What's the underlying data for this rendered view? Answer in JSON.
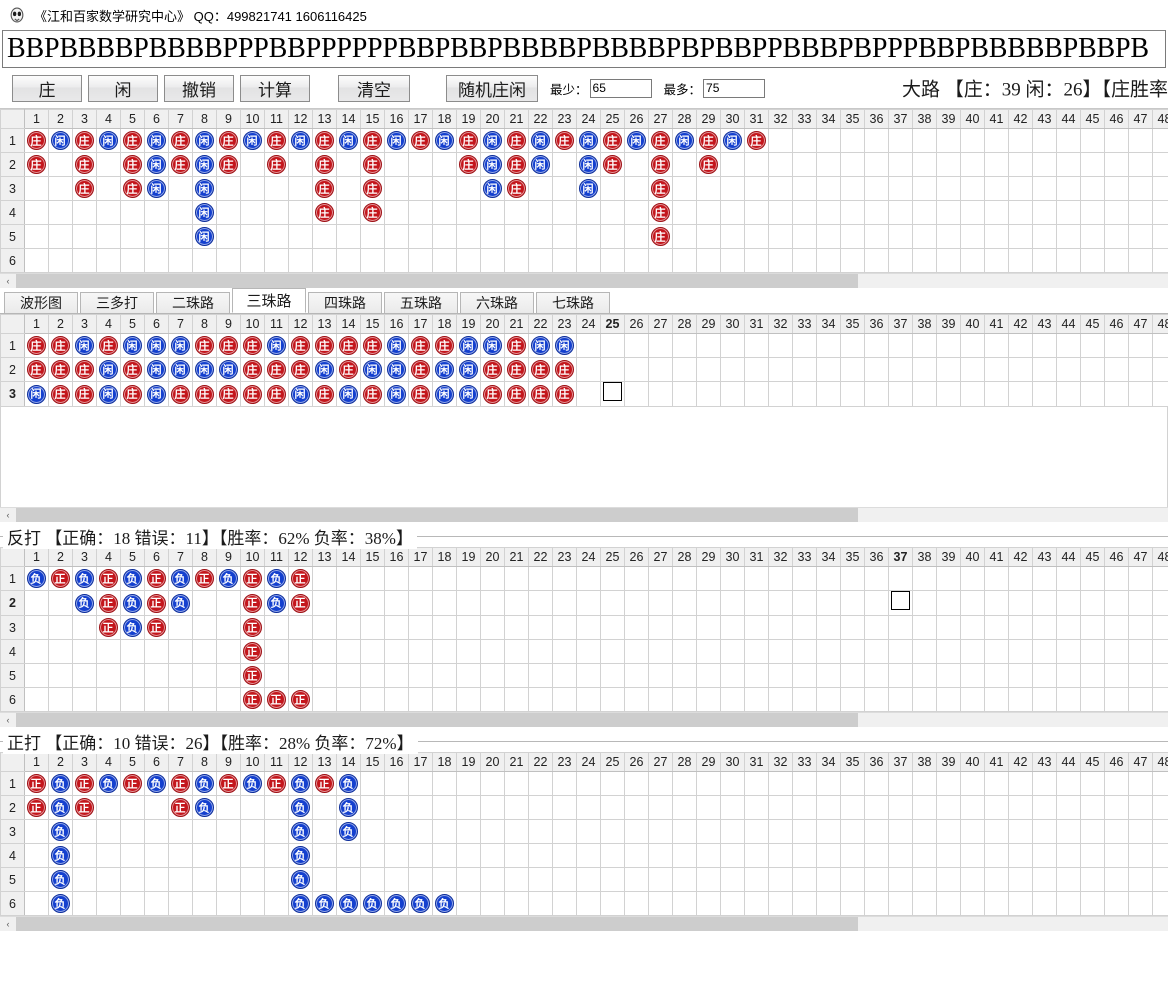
{
  "window": {
    "icon": "app-icon",
    "title": "《江和百家数学研究中心》 QQ：499821741 1606116425"
  },
  "sequence": {
    "value": "BBPBBBBPBBBBPPPBBPPPPPPBBPBBPBBBBPBBBBPBPBBPPBBBPBPPPBBPBBBBBPBBPB"
  },
  "toolbar": {
    "banker_label": "庄",
    "player_label": "闲",
    "undo_label": "撤销",
    "calc_label": "计算",
    "clear_label": "清空",
    "random_label": "随机庄闲",
    "min_label": "最少：",
    "min_value": "65",
    "max_label": "最多：",
    "max_value": "75",
    "stats": "大路 【庄：39 闲：26】【庄胜率"
  },
  "tabs": [
    {
      "label": "波形图",
      "active": false
    },
    {
      "label": "三多打",
      "active": false
    },
    {
      "label": "二珠路",
      "active": false
    },
    {
      "label": "三珠路",
      "active": true
    },
    {
      "label": "四珠路",
      "active": false
    },
    {
      "label": "五珠路",
      "active": false
    },
    {
      "label": "六珠路",
      "active": false
    },
    {
      "label": "七珠路",
      "active": false
    }
  ],
  "marker_labels": {
    "B": "庄",
    "P": "闲",
    "Z": "正",
    "F": "负"
  },
  "big_road": {
    "columns": 48,
    "rows": 6,
    "row_labels": [
      "1",
      "2",
      "3",
      "4",
      "5",
      "6"
    ],
    "cells": [
      [
        "B",
        "P",
        "B",
        "P",
        "B",
        "P",
        "B",
        "P",
        "B",
        "P",
        "B",
        "P",
        "B",
        "P",
        "B",
        "P",
        "B",
        "P",
        "B",
        "P",
        "B",
        "P",
        "B",
        "P",
        "B",
        "P",
        "B",
        "P",
        "B",
        "P",
        "B",
        "",
        "",
        "",
        "",
        "",
        "",
        "",
        "",
        "",
        "",
        "",
        "",
        "",
        "",
        "",
        "",
        ""
      ],
      [
        "B",
        "",
        "B",
        "",
        "B",
        "P",
        "B",
        "P",
        "B",
        "",
        "B",
        "",
        "B",
        "",
        "B",
        "",
        "",
        "",
        "B",
        "P",
        "B",
        "P",
        "",
        "P",
        "B",
        "",
        "B",
        "",
        "B",
        "",
        "",
        "",
        "",
        "",
        "",
        "",
        "",
        "",
        "",
        "",
        "",
        "",
        "",
        "",
        "",
        "",
        "",
        ""
      ],
      [
        "",
        "",
        "B",
        "",
        "B",
        "P",
        "",
        "P",
        "",
        "",
        "",
        "",
        "B",
        "",
        "B",
        "",
        "",
        "",
        "",
        "P",
        "B",
        "",
        "",
        "P",
        "",
        "",
        "B",
        "",
        "",
        "",
        "",
        "",
        "",
        "",
        "",
        "",
        "",
        "",
        "",
        "",
        "",
        "",
        "",
        "",
        "",
        "",
        "",
        ""
      ],
      [
        "",
        "",
        "",
        "",
        "",
        "",
        "",
        "P",
        "",
        "",
        "",
        "",
        "B",
        "",
        "B",
        "",
        "",
        "",
        "",
        "",
        "",
        "",
        "",
        "",
        "",
        "",
        "B",
        "",
        "",
        "",
        "",
        "",
        "",
        "",
        "",
        "",
        "",
        "",
        "",
        "",
        "",
        "",
        "",
        "",
        "",
        "",
        "",
        ""
      ],
      [
        "",
        "",
        "",
        "",
        "",
        "",
        "",
        "P",
        "",
        "",
        "",
        "",
        "",
        "",
        "",
        "",
        "",
        "",
        "",
        "",
        "",
        "",
        "",
        "",
        "",
        "",
        "B",
        "",
        "",
        "",
        "",
        "",
        "",
        "",
        "",
        "",
        "",
        "",
        "",
        "",
        "",
        "",
        "",
        "",
        "",
        "",
        "",
        ""
      ],
      [
        "",
        "",
        "",
        "",
        "",
        "",
        "",
        "",
        "",
        "",
        "",
        "",
        "",
        "",
        "",
        "",
        "",
        "",
        "",
        "",
        "",
        "",
        "",
        "",
        "",
        "",
        "",
        "",
        "",
        "",
        "",
        "",
        "",
        "",
        "",
        "",
        "",
        "",
        "",
        "",
        "",
        "",
        "",
        "",
        "",
        "",
        "",
        ""
      ]
    ]
  },
  "bead_road": {
    "columns": 48,
    "rows": 3,
    "row_labels": [
      "1",
      "2",
      "3"
    ],
    "selected_column": 25,
    "selected_row": 3,
    "focus_cell": {
      "row": 3,
      "col": 25
    },
    "cells": [
      [
        "B",
        "B",
        "P",
        "B",
        "P",
        "P",
        "P",
        "B",
        "B",
        "B",
        "P",
        "B",
        "B",
        "B",
        "B",
        "P",
        "B",
        "B",
        "P",
        "P",
        "B",
        "P",
        "P",
        "",
        "",
        "",
        "",
        "",
        "",
        "",
        "",
        "",
        "",
        "",
        "",
        "",
        "",
        "",
        "",
        "",
        "",
        "",
        "",
        "",
        "",
        "",
        "",
        ""
      ],
      [
        "B",
        "B",
        "B",
        "P",
        "B",
        "P",
        "P",
        "P",
        "P",
        "B",
        "B",
        "B",
        "P",
        "B",
        "P",
        "P",
        "B",
        "P",
        "P",
        "B",
        "B",
        "B",
        "B",
        "",
        "",
        "",
        "",
        "",
        "",
        "",
        "",
        "",
        "",
        "",
        "",
        "",
        "",
        "",
        "",
        "",
        "",
        "",
        "",
        "",
        "",
        "",
        "",
        ""
      ],
      [
        "P",
        "B",
        "B",
        "P",
        "B",
        "P",
        "B",
        "B",
        "B",
        "B",
        "B",
        "P",
        "B",
        "P",
        "B",
        "P",
        "B",
        "P",
        "P",
        "B",
        "B",
        "B",
        "B",
        "",
        "",
        "",
        "",
        "",
        "",
        "",
        "",
        "",
        "",
        "",
        "",
        "",
        "",
        "",
        "",
        "",
        "",
        "",
        "",
        "",
        "",
        "",
        "",
        ""
      ]
    ]
  },
  "fanda": {
    "title": "反打 【正确：18 错误：11】【胜率：62% 负率：38%】",
    "columns": 48,
    "rows": 6,
    "row_labels": [
      "1",
      "2",
      "3",
      "4",
      "5",
      "6"
    ],
    "selected_column": 37,
    "selected_row": 2,
    "focus_cell": {
      "row": 2,
      "col": 37
    },
    "cells": [
      [
        "F",
        "Z",
        "F",
        "Z",
        "F",
        "Z",
        "F",
        "Z",
        "F",
        "Z",
        "F",
        "Z",
        "",
        "",
        "",
        "",
        "",
        "",
        "",
        "",
        "",
        "",
        "",
        "",
        "",
        "",
        "",
        "",
        "",
        "",
        "",
        "",
        "",
        "",
        "",
        "",
        "",
        "",
        "",
        "",
        "",
        "",
        "",
        "",
        "",
        "",
        "",
        ""
      ],
      [
        "",
        "",
        "F",
        "Z",
        "F",
        "Z",
        "F",
        "",
        "",
        "Z",
        "F",
        "Z",
        "",
        "",
        "",
        "",
        "",
        "",
        "",
        "",
        "",
        "",
        "",
        "",
        "",
        "",
        "",
        "",
        "",
        "",
        "",
        "",
        "",
        "",
        "",
        "",
        "",
        "",
        "",
        "",
        "",
        "",
        "",
        "",
        "",
        "",
        "",
        ""
      ],
      [
        "",
        "",
        "",
        "Z",
        "F",
        "Z",
        "",
        "",
        "",
        "Z",
        "",
        "",
        "",
        "",
        "",
        "",
        "",
        "",
        "",
        "",
        "",
        "",
        "",
        "",
        "",
        "",
        "",
        "",
        "",
        "",
        "",
        "",
        "",
        "",
        "",
        "",
        "",
        "",
        "",
        "",
        "",
        "",
        "",
        "",
        "",
        "",
        "",
        ""
      ],
      [
        "",
        "",
        "",
        "",
        "",
        "",
        "",
        "",
        "",
        "Z",
        "",
        "",
        "",
        "",
        "",
        "",
        "",
        "",
        "",
        "",
        "",
        "",
        "",
        "",
        "",
        "",
        "",
        "",
        "",
        "",
        "",
        "",
        "",
        "",
        "",
        "",
        "",
        "",
        "",
        "",
        "",
        "",
        "",
        "",
        "",
        "",
        "",
        ""
      ],
      [
        "",
        "",
        "",
        "",
        "",
        "",
        "",
        "",
        "",
        "Z",
        "",
        "",
        "",
        "",
        "",
        "",
        "",
        "",
        "",
        "",
        "",
        "",
        "",
        "",
        "",
        "",
        "",
        "",
        "",
        "",
        "",
        "",
        "",
        "",
        "",
        "",
        "",
        "",
        "",
        "",
        "",
        "",
        "",
        "",
        "",
        "",
        "",
        ""
      ],
      [
        "",
        "",
        "",
        "",
        "",
        "",
        "",
        "",
        "",
        "Z",
        "Z",
        "Z",
        "",
        "",
        "",
        "",
        "",
        "",
        "",
        "",
        "",
        "",
        "",
        "",
        "",
        "",
        "",
        "",
        "",
        "",
        "",
        "",
        "",
        "",
        "",
        "",
        "",
        "",
        "",
        "",
        "",
        "",
        "",
        "",
        "",
        "",
        "",
        ""
      ]
    ]
  },
  "zhengda": {
    "title": "正打 【正确：10 错误：26】【胜率：28% 负率：72%】",
    "columns": 48,
    "rows": 6,
    "row_labels": [
      "1",
      "2",
      "3",
      "4",
      "5",
      "6"
    ],
    "cells": [
      [
        "Z",
        "F",
        "Z",
        "F",
        "Z",
        "F",
        "Z",
        "F",
        "Z",
        "F",
        "Z",
        "F",
        "Z",
        "F",
        "",
        "",
        "",
        "",
        "",
        "",
        "",
        "",
        "",
        "",
        "",
        "",
        "",
        "",
        "",
        "",
        "",
        "",
        "",
        "",
        "",
        "",
        "",
        "",
        "",
        "",
        "",
        "",
        "",
        "",
        "",
        "",
        "",
        ""
      ],
      [
        "Z",
        "F",
        "Z",
        "",
        "",
        "",
        "Z",
        "F",
        "",
        "",
        "",
        "F",
        "",
        "F",
        "",
        "",
        "",
        "",
        "",
        "",
        "",
        "",
        "",
        "",
        "",
        "",
        "",
        "",
        "",
        "",
        "",
        "",
        "",
        "",
        "",
        "",
        "",
        "",
        "",
        "",
        "",
        "",
        "",
        "",
        "",
        "",
        "",
        ""
      ],
      [
        "",
        "F",
        "",
        "",
        "",
        "",
        "",
        "",
        "",
        "",
        "",
        "F",
        "",
        "F",
        "",
        "",
        "",
        "",
        "",
        "",
        "",
        "",
        "",
        "",
        "",
        "",
        "",
        "",
        "",
        "",
        "",
        "",
        "",
        "",
        "",
        "",
        "",
        "",
        "",
        "",
        "",
        "",
        "",
        "",
        "",
        "",
        "",
        ""
      ],
      [
        "",
        "F",
        "",
        "",
        "",
        "",
        "",
        "",
        "",
        "",
        "",
        "F",
        "",
        "",
        "",
        "",
        "",
        "",
        "",
        "",
        "",
        "",
        "",
        "",
        "",
        "",
        "",
        "",
        "",
        "",
        "",
        "",
        "",
        "",
        "",
        "",
        "",
        "",
        "",
        "",
        "",
        "",
        "",
        "",
        "",
        "",
        "",
        ""
      ],
      [
        "",
        "F",
        "",
        "",
        "",
        "",
        "",
        "",
        "",
        "",
        "",
        "F",
        "",
        "",
        "",
        "",
        "",
        "",
        "",
        "",
        "",
        "",
        "",
        "",
        "",
        "",
        "",
        "",
        "",
        "",
        "",
        "",
        "",
        "",
        "",
        "",
        "",
        "",
        "",
        "",
        "",
        "",
        "",
        "",
        "",
        "",
        "",
        ""
      ],
      [
        "",
        "F",
        "",
        "",
        "",
        "",
        "",
        "",
        "",
        "",
        "",
        "F",
        "F",
        "F",
        "F",
        "F",
        "F",
        "F",
        "",
        "",
        "",
        "",
        "",
        "",
        "",
        "",
        "",
        "",
        "",
        "",
        "",
        "",
        "",
        "",
        "",
        "",
        "",
        "",
        "",
        "",
        "",
        "",
        "",
        "",
        "",
        "",
        "",
        ""
      ]
    ]
  },
  "scrollbars": {
    "left_arrow": "‹",
    "right_arrow": "›"
  }
}
